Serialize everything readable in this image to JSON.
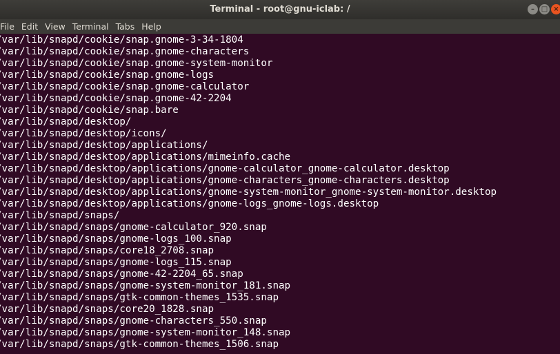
{
  "window": {
    "title": "Terminal - root@gnu-iclab: /",
    "controls": {
      "minimize": "–",
      "maximize": "□",
      "close": "×"
    }
  },
  "menu": [
    "File",
    "Edit",
    "View",
    "Terminal",
    "Tabs",
    "Help"
  ],
  "terminal": {
    "lines": [
      "/var/lib/snapd/cookie/snap.gnome-3-34-1804",
      "/var/lib/snapd/cookie/snap.gnome-characters",
      "/var/lib/snapd/cookie/snap.gnome-system-monitor",
      "/var/lib/snapd/cookie/snap.gnome-logs",
      "/var/lib/snapd/cookie/snap.gnome-calculator",
      "/var/lib/snapd/cookie/snap.gnome-42-2204",
      "/var/lib/snapd/cookie/snap.bare",
      "/var/lib/snapd/desktop/",
      "/var/lib/snapd/desktop/icons/",
      "/var/lib/snapd/desktop/applications/",
      "/var/lib/snapd/desktop/applications/mimeinfo.cache",
      "/var/lib/snapd/desktop/applications/gnome-calculator_gnome-calculator.desktop",
      "/var/lib/snapd/desktop/applications/gnome-characters_gnome-characters.desktop",
      "/var/lib/snapd/desktop/applications/gnome-system-monitor_gnome-system-monitor.desktop",
      "/var/lib/snapd/desktop/applications/gnome-logs_gnome-logs.desktop",
      "/var/lib/snapd/snaps/",
      "/var/lib/snapd/snaps/gnome-calculator_920.snap",
      "/var/lib/snapd/snaps/gnome-logs_100.snap",
      "/var/lib/snapd/snaps/core18_2708.snap",
      "/var/lib/snapd/snaps/gnome-logs_115.snap",
      "/var/lib/snapd/snaps/gnome-42-2204_65.snap",
      "/var/lib/snapd/snaps/gnome-system-monitor_181.snap",
      "/var/lib/snapd/snaps/gtk-common-themes_1535.snap",
      "/var/lib/snapd/snaps/core20_1828.snap",
      "/var/lib/snapd/snaps/gnome-characters_550.snap",
      "/var/lib/snapd/snaps/gnome-system-monitor_148.snap",
      "/var/lib/snapd/snaps/gtk-common-themes_1506.snap"
    ]
  },
  "colors": {
    "terminal_bg": "#300a24",
    "terminal_fg": "#ffffff",
    "titlebar_bg": "#3c3b37",
    "close_button": "#e95420"
  }
}
